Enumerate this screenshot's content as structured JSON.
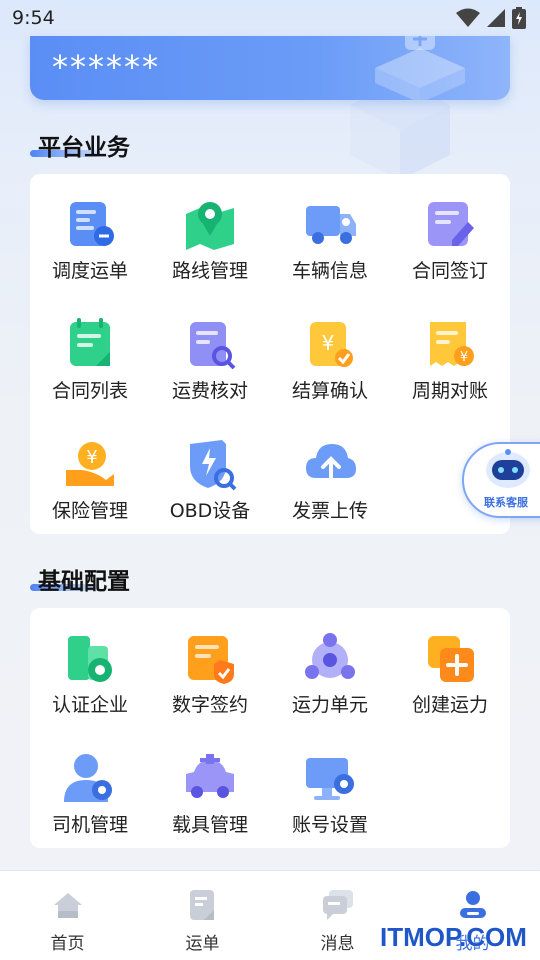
{
  "status_bar": {
    "time": "9:54"
  },
  "account": {
    "masked_value": "******"
  },
  "sections": [
    {
      "title": "平台业务",
      "items": [
        {
          "label": "调度运单",
          "icon": "dispatch-waybill-icon"
        },
        {
          "label": "路线管理",
          "icon": "route-map-icon"
        },
        {
          "label": "车辆信息",
          "icon": "truck-icon"
        },
        {
          "label": "合同签订",
          "icon": "contract-sign-icon"
        },
        {
          "label": "合同列表",
          "icon": "contract-list-icon"
        },
        {
          "label": "运费核对",
          "icon": "freight-check-icon"
        },
        {
          "label": "结算确认",
          "icon": "settlement-confirm-icon"
        },
        {
          "label": "周期对账",
          "icon": "periodic-reconcile-icon"
        },
        {
          "label": "保险管理",
          "icon": "insurance-icon"
        },
        {
          "label": "OBD设备",
          "icon": "obd-device-icon"
        },
        {
          "label": "发票上传",
          "icon": "invoice-upload-icon"
        }
      ]
    },
    {
      "title": "基础配置",
      "items": [
        {
          "label": "认证企业",
          "icon": "certified-company-icon"
        },
        {
          "label": "数字签约",
          "icon": "digital-sign-icon"
        },
        {
          "label": "运力单元",
          "icon": "capacity-unit-icon"
        },
        {
          "label": "创建运力",
          "icon": "create-capacity-icon"
        },
        {
          "label": "司机管理",
          "icon": "driver-icon"
        },
        {
          "label": "载具管理",
          "icon": "vehicle-icon"
        },
        {
          "label": "账号设置",
          "icon": "account-settings-icon"
        }
      ]
    }
  ],
  "support": {
    "label": "联系客服",
    "icon": "robot-support-icon"
  },
  "tab_bar": {
    "tabs": [
      {
        "label": "首页",
        "icon": "home-icon",
        "active": false
      },
      {
        "label": "运单",
        "icon": "waybill-icon",
        "active": false
      },
      {
        "label": "消息",
        "icon": "message-icon",
        "active": false
      },
      {
        "label": "我的",
        "icon": "profile-icon",
        "active": true
      }
    ]
  },
  "watermark": "ITMOP.COM",
  "colors": {
    "accent": "#3b6fe0",
    "primary_blue": "#5b8ef5",
    "green": "#2fd08a",
    "orange": "#ff9f1c",
    "purple": "#8f8ff5"
  }
}
